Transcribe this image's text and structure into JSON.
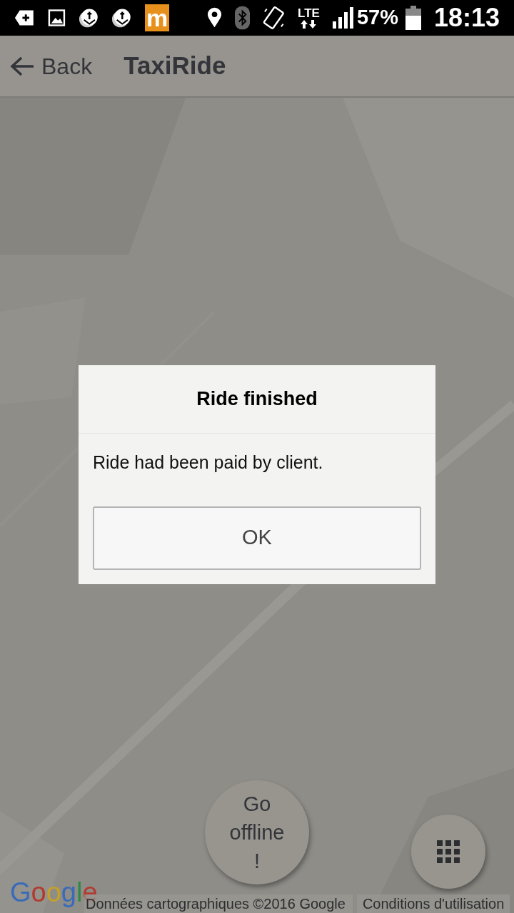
{
  "status_bar": {
    "app_icon_letter": "m",
    "network": "LTE",
    "battery": "57%",
    "time": "18:13"
  },
  "app_bar": {
    "back_label": "Back",
    "title": "TaxiRide"
  },
  "map": {
    "kind": "picture",
    "logo": "Google",
    "attribution": "Données cartographiques ©2016 Google",
    "terms_link": "Conditions d'utilisation"
  },
  "dialog": {
    "title": "Ride finished",
    "message": "Ride had been paid by client.",
    "buttons": [
      "OK"
    ]
  },
  "fabs": [
    {
      "kind": "text",
      "label": "Go offline !"
    },
    {
      "kind": "grid"
    }
  ]
}
